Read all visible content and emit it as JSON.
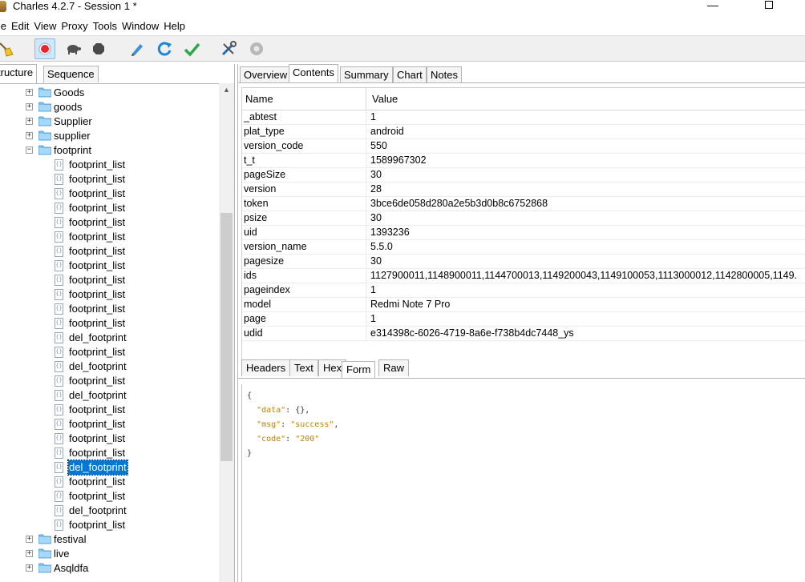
{
  "window": {
    "title": "Charles 4.2.7 - Session 1 *",
    "minimize": "—",
    "maximize": ""
  },
  "menu": [
    "File",
    "Edit",
    "View",
    "Proxy",
    "Tools",
    "Window",
    "Help"
  ],
  "menu_display": [
    "ile",
    "Edit",
    "View",
    "Proxy",
    "Tools",
    "Window",
    "Help"
  ],
  "toolbar": {
    "icons": [
      "broom-icon",
      "record-icon",
      "turtle-icon",
      "stop-icon",
      "pen-icon",
      "refresh-icon",
      "check-icon",
      "tools-icon",
      "settings-icon"
    ]
  },
  "left_tabs": {
    "structure": "Structure",
    "structure_display": "tructure",
    "sequence": "Sequence"
  },
  "tree": [
    {
      "label": "Goods",
      "type": "folder",
      "expander": "+"
    },
    {
      "label": "goods",
      "type": "folder",
      "expander": "+"
    },
    {
      "label": "Supplier",
      "type": "folder",
      "expander": "+"
    },
    {
      "label": "supplier",
      "type": "folder",
      "expander": "+"
    },
    {
      "label": "footprint",
      "type": "folder",
      "expander": "−"
    },
    {
      "label": "footprint_list",
      "type": "file"
    },
    {
      "label": "footprint_list",
      "type": "file"
    },
    {
      "label": "footprint_list",
      "type": "file"
    },
    {
      "label": "footprint_list",
      "type": "file"
    },
    {
      "label": "footprint_list",
      "type": "file"
    },
    {
      "label": "footprint_list",
      "type": "file"
    },
    {
      "label": "footprint_list",
      "type": "file"
    },
    {
      "label": "footprint_list",
      "type": "file"
    },
    {
      "label": "footprint_list",
      "type": "file"
    },
    {
      "label": "footprint_list",
      "type": "file"
    },
    {
      "label": "footprint_list",
      "type": "file"
    },
    {
      "label": "footprint_list",
      "type": "file"
    },
    {
      "label": "del_footprint",
      "type": "file"
    },
    {
      "label": "footprint_list",
      "type": "file"
    },
    {
      "label": "del_footprint",
      "type": "file"
    },
    {
      "label": "footprint_list",
      "type": "file"
    },
    {
      "label": "del_footprint",
      "type": "file"
    },
    {
      "label": "footprint_list",
      "type": "file"
    },
    {
      "label": "footprint_list",
      "type": "file"
    },
    {
      "label": "footprint_list",
      "type": "file"
    },
    {
      "label": "footprint_list",
      "type": "file"
    },
    {
      "label": "del_footprint",
      "type": "file",
      "selected": true
    },
    {
      "label": "footprint_list",
      "type": "file"
    },
    {
      "label": "footprint_list",
      "type": "file"
    },
    {
      "label": "del_footprint",
      "type": "file"
    },
    {
      "label": "footprint_list",
      "type": "file"
    },
    {
      "label": "festival",
      "type": "folder",
      "expander": "+"
    },
    {
      "label": "live",
      "type": "folder",
      "expander": "+"
    },
    {
      "label": "Asqldfa",
      "type": "folder",
      "expander": "+"
    }
  ],
  "right_tabs": [
    "Overview",
    "Contents",
    "Summary",
    "Chart",
    "Notes"
  ],
  "right_tabs_active": "Contents",
  "table": {
    "headers": {
      "name": "Name",
      "value": "Value"
    },
    "rows": [
      {
        "name": "_abtest",
        "value": "1"
      },
      {
        "name": "plat_type",
        "value": "android"
      },
      {
        "name": "version_code",
        "value": "550"
      },
      {
        "name": "t_t",
        "value": "1589967302"
      },
      {
        "name": "pageSize",
        "value": "30"
      },
      {
        "name": "version",
        "value": "28"
      },
      {
        "name": "token",
        "value": "3bce6de058d280a2e5b3d0b8c6752868"
      },
      {
        "name": "psize",
        "value": "30"
      },
      {
        "name": "uid",
        "value": "1393236"
      },
      {
        "name": "version_name",
        "value": "5.5.0"
      },
      {
        "name": "pagesize",
        "value": "30"
      },
      {
        "name": "ids",
        "value": "1127900011,1148900011,1144700013,1149200043,1149100053,1113000012,1142800005,1149."
      },
      {
        "name": "pageindex",
        "value": "1"
      },
      {
        "name": "model",
        "value": "Redmi Note 7 Pro"
      },
      {
        "name": "page",
        "value": "1"
      },
      {
        "name": "udid",
        "value": "e314398c-6026-4719-8a6e-f738b4dc7448_ys"
      }
    ]
  },
  "bottom_tabs": [
    "Headers",
    "Text",
    "Hex",
    "Form",
    "Raw"
  ],
  "bottom_tabs_active": "Form",
  "json_lines": [
    "{",
    "  \"data\": {},",
    "  \"msg\": \"success\",",
    "  \"code\": \"200\"",
    "}"
  ]
}
